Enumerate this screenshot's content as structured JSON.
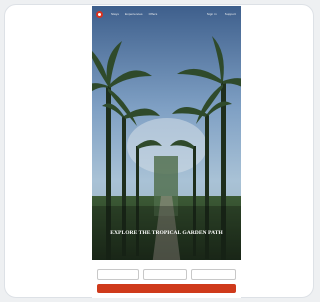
{
  "header": {
    "nav_items": [
      "Stays",
      "Experiences",
      "Offers"
    ],
    "right_items": [
      "Sign in",
      "Support"
    ]
  },
  "hero": {
    "badge": "",
    "headline": "EXPLORE THE TROPICAL GARDEN PATH",
    "subtext": ""
  },
  "booking": {
    "title": "",
    "fields": [
      {
        "label": "",
        "value": ""
      },
      {
        "label": "",
        "value": ""
      },
      {
        "label": "",
        "value": ""
      }
    ],
    "cta": ""
  },
  "colors": {
    "brand": "#d9321f",
    "cta": "#cf3a1b"
  }
}
